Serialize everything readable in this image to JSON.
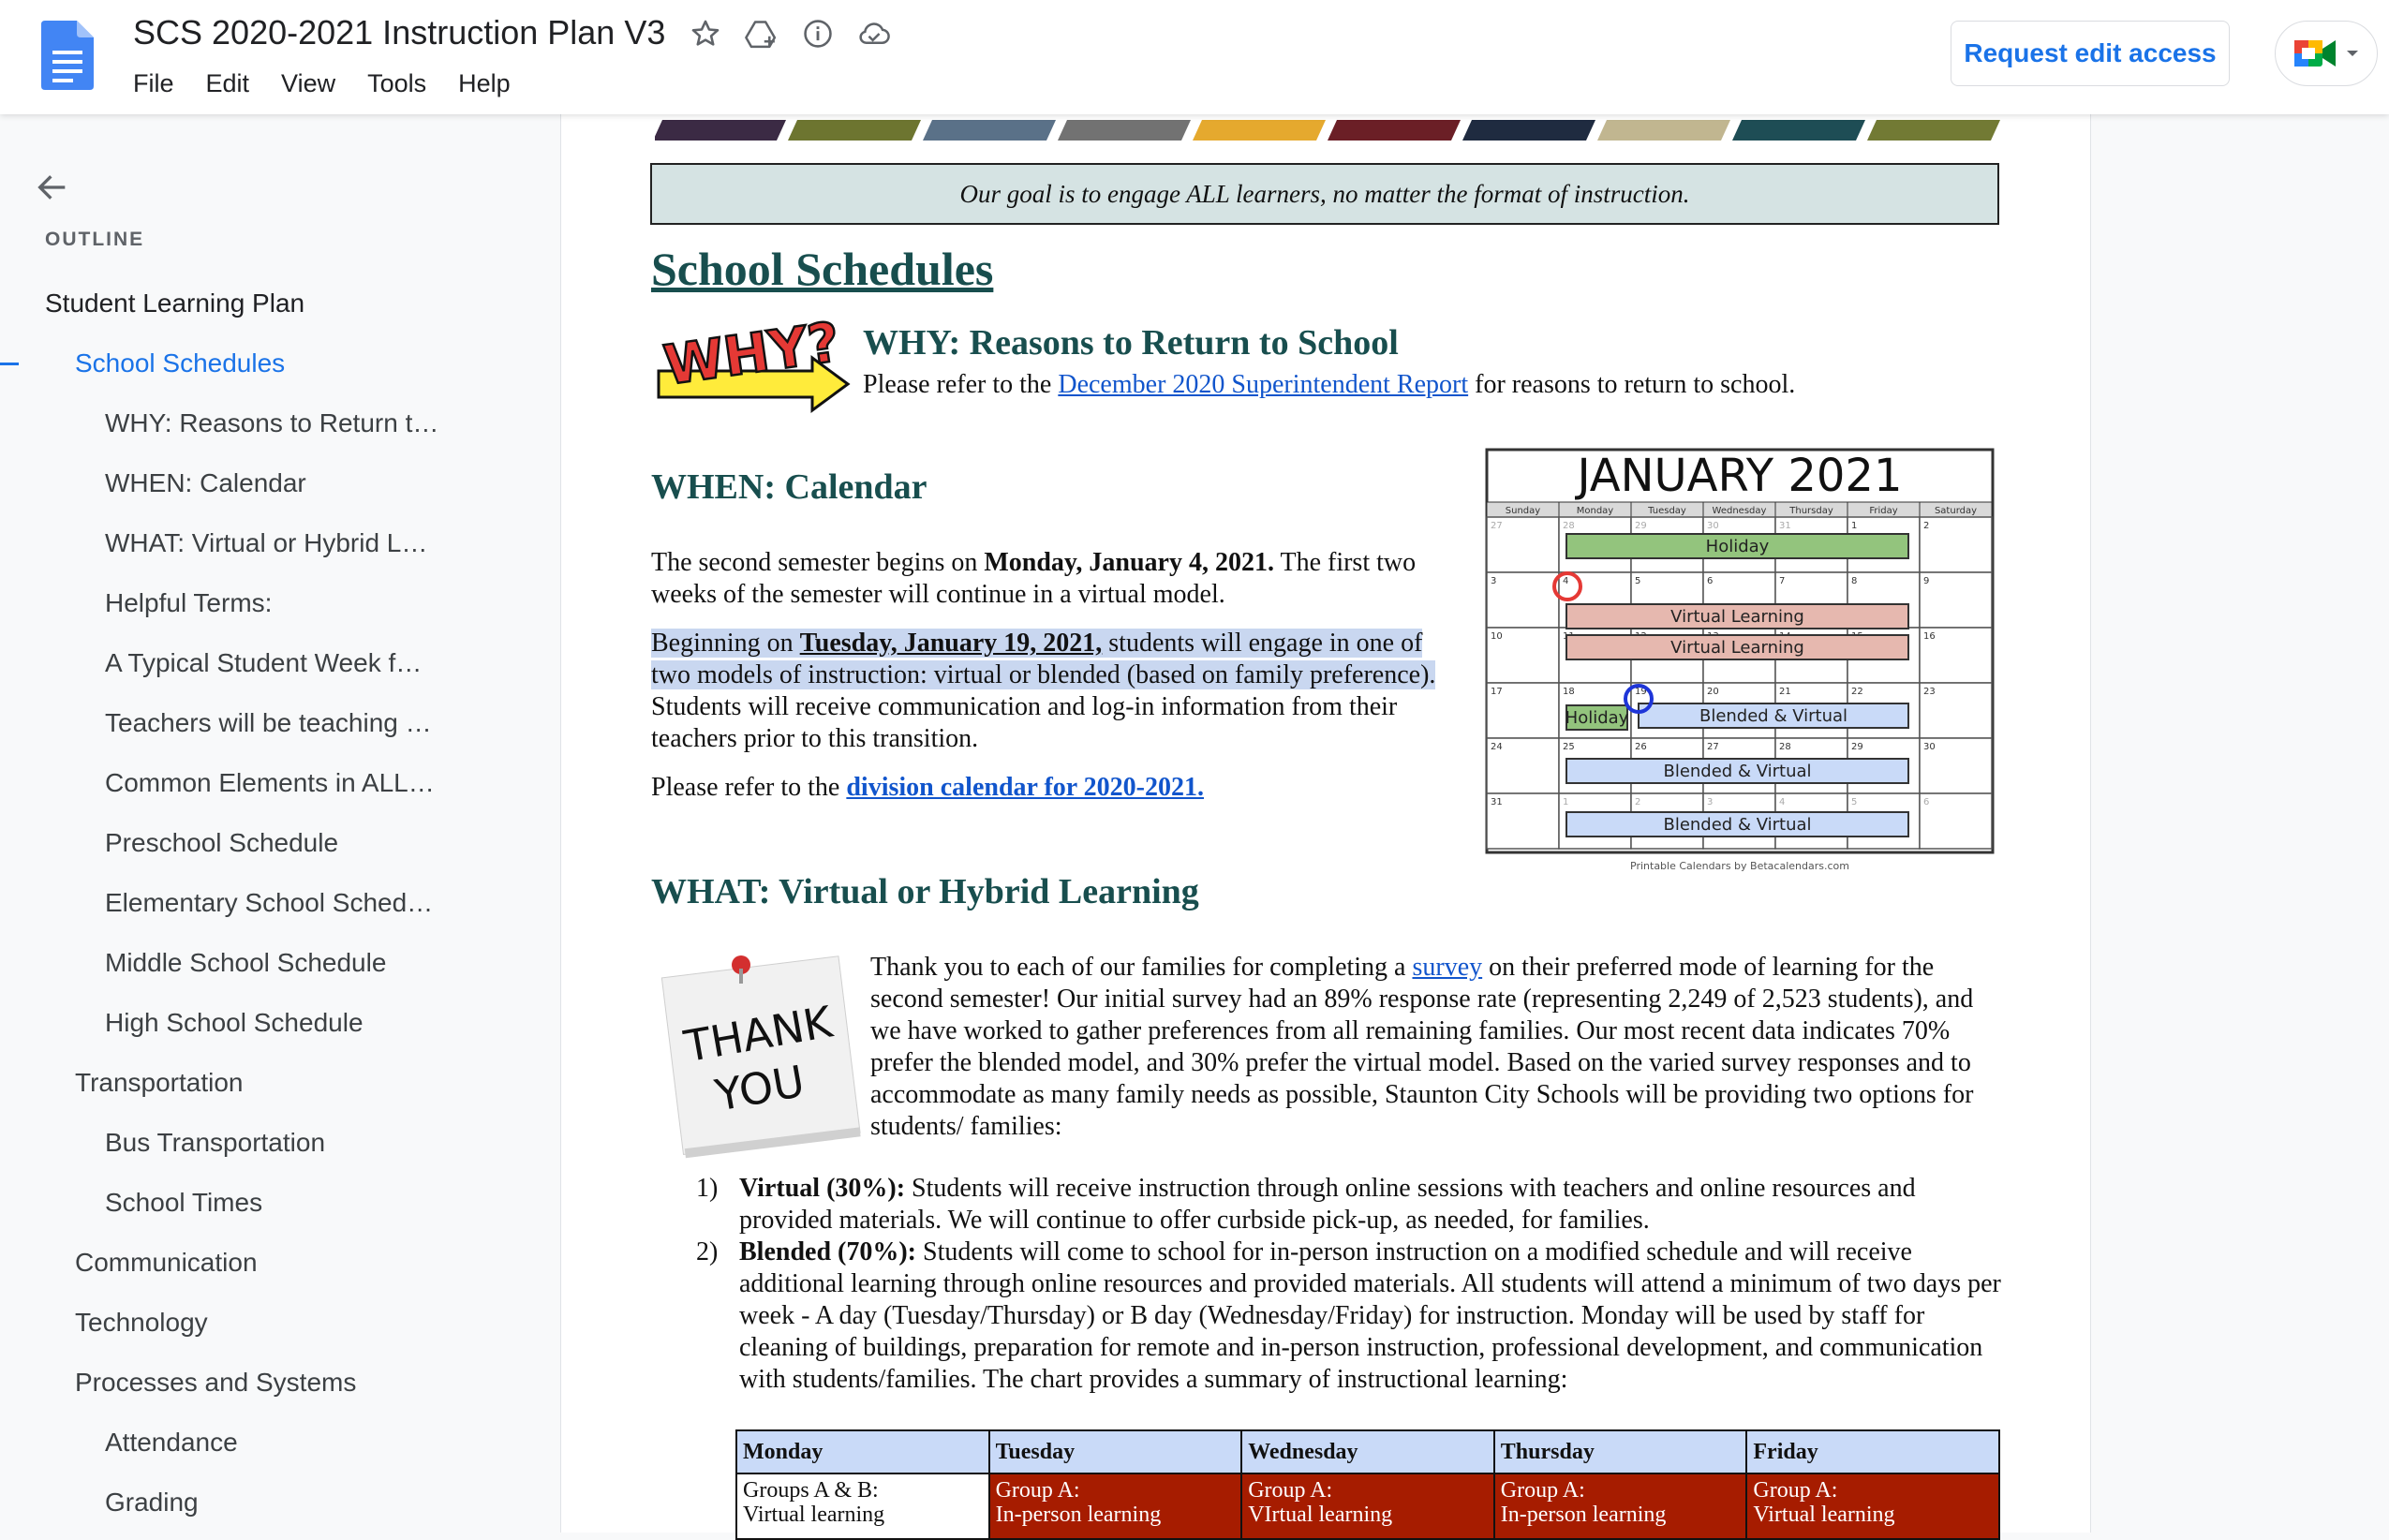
{
  "app": {
    "title": "SCS 2020-2021 Instruction Plan V3",
    "menu": [
      "File",
      "Edit",
      "View",
      "Tools",
      "Help"
    ],
    "request_edit_label": "Request edit access",
    "icons": [
      "star-icon",
      "move-to-drive-icon",
      "info-icon",
      "cloud-status-icon"
    ]
  },
  "sidebar": {
    "heading": "OUTLINE",
    "items": [
      {
        "label": "Student Learning Plan",
        "level": 1
      },
      {
        "label": "School Schedules",
        "level": 2,
        "active": true
      },
      {
        "label": "WHY: Reasons to Return t…",
        "level": 3
      },
      {
        "label": "WHEN: Calendar",
        "level": 3
      },
      {
        "label": "WHAT: Virtual or Hybrid L…",
        "level": 3
      },
      {
        "label": "Helpful Terms:",
        "level": 3
      },
      {
        "label": "A Typical Student Week f…",
        "level": 3
      },
      {
        "label": "Teachers will be teaching …",
        "level": 3
      },
      {
        "label": "Common Elements in ALL…",
        "level": 3
      },
      {
        "label": "Preschool Schedule",
        "level": 3
      },
      {
        "label": "Elementary School Sched…",
        "level": 3
      },
      {
        "label": "Middle School Schedule",
        "level": 3
      },
      {
        "label": "High School Schedule",
        "level": 3
      },
      {
        "label": "Transportation",
        "level": 2
      },
      {
        "label": "Bus Transportation",
        "level": 3
      },
      {
        "label": "School Times",
        "level": 3
      },
      {
        "label": "Communication",
        "level": 2
      },
      {
        "label": "Technology",
        "level": 2
      },
      {
        "label": "Processes and Systems",
        "level": 2
      },
      {
        "label": "Attendance",
        "level": 3
      },
      {
        "label": "Grading",
        "level": 3
      }
    ]
  },
  "doc": {
    "stripe_colors": [
      "#3b2a44",
      "#6d7530",
      "#5a7188",
      "#727272",
      "#e5a92e",
      "#6b1f26",
      "#1f2b40",
      "#c1b690",
      "#1e4d55",
      "#727a34"
    ],
    "goal": "Our goal is to engage ALL learners, no matter the format of instruction.",
    "page_title": "School Schedules",
    "why": {
      "heading": "WHY:  Reasons to Return to School",
      "art_text": "WHY?",
      "pre": "Please refer to the ",
      "link": "December 2020 Superintendent Report",
      "post": " for reasons to return to school."
    },
    "when": {
      "heading": "WHEN:  Calendar",
      "p1_pre": "The second semester begins on ",
      "p1_bold": "Monday, January 4, 2021.",
      "p1_post": "  The first two weeks of the semester will continue in a virtual model.",
      "p2_pre": "Beginning on ",
      "p2_bold": "Tuesday, January 19, 2021,",
      "p2_mid": " students will engage in one of two models of instruction:  virtual or blended (based on family preference).",
      "p2_post": "  Students will receive communication and log-in information from their teachers prior to this transition.",
      "p3_pre": "Please refer to the ",
      "p3_link": "division calendar for 2020-2021."
    },
    "calendar": {
      "title": "JANUARY 2021",
      "days": [
        "Sunday",
        "Monday",
        "Tuesday",
        "Wednesday",
        "Thursday",
        "Friday",
        "Saturday"
      ],
      "weeks": [
        [
          "27",
          "28",
          "29",
          "30",
          "31",
          "1",
          "2"
        ],
        [
          "3",
          "4",
          "5",
          "6",
          "7",
          "8",
          "9"
        ],
        [
          "10",
          "11",
          "12",
          "13",
          "14",
          "15",
          "16"
        ],
        [
          "17",
          "18",
          "19",
          "20",
          "21",
          "22",
          "23"
        ],
        [
          "24",
          "25",
          "26",
          "27",
          "28",
          "29",
          "30"
        ],
        [
          "31",
          "1",
          "2",
          "3",
          "4",
          "5",
          "6"
        ]
      ],
      "bars": [
        {
          "label": "Holiday",
          "color": "#93c47d"
        },
        {
          "label": "Virtual Learning",
          "color": "#e6b8af"
        },
        {
          "label": "Virtual Learning",
          "color": "#e6b8af"
        },
        {
          "label": "Holiday",
          "color": "#93c47d"
        },
        {
          "label": "Blended & Virtual",
          "color": "#c9daf8"
        },
        {
          "label": "Blended & Virtual",
          "color": "#c9daf8"
        },
        {
          "label": "Blended & Virtual",
          "color": "#c9daf8"
        }
      ],
      "credit": "Printable Calendars by Betacalendars.com"
    },
    "what": {
      "heading": "WHAT:  Virtual or Hybrid Learning",
      "note_line1": "THANK",
      "note_line2": "YOU",
      "intro_pre": "Thank you to each of our families for completing a ",
      "intro_link": "survey",
      "intro_post": " on their preferred mode of learning for the second semester!  Our initial survey had an 89% response rate (representing 2,249 of 2,523 students), and we have worked to gather preferences from all remaining families.  Our most recent data indicates 70% prefer the blended model, and 30% prefer the virtual model.  Based on the varied survey responses and to accommodate as many family needs as possible, Staunton City Schools will be providing two options for students/ families:",
      "list": [
        {
          "num": "1)",
          "bold": "Virtual (30%):",
          "text": "  Students will receive instruction through online sessions with teachers and online resources and provided materials.  We will continue to offer curbside pick-up, as needed, for families."
        },
        {
          "num": "2)",
          "bold": "Blended (70%):",
          "text": "  Students will come to school for in-person instruction on a modified schedule and will receive additional learning through online resources and provided materials.  All students will attend a minimum of two days per week - A day (Tuesday/Thursday) or B day (Wednesday/Friday) for instruction.  Monday will be used by staff for cleaning of buildings, preparation for remote and in-person instruction, professional development, and communication with students/families.  The chart provides a summary of instructional learning:"
        }
      ]
    },
    "schedule": {
      "headers": [
        "Monday",
        "Tuesday",
        "Wednesday",
        "Thursday",
        "Friday"
      ],
      "row": [
        [
          "Groups A & B:",
          "Virtual learning"
        ],
        [
          "Group A:",
          "In-person learning"
        ],
        [
          "Group A:",
          "VIrtual learning"
        ],
        [
          "Group A:",
          "In-person learning"
        ],
        [
          "Group A:",
          "Virtual learning"
        ]
      ]
    }
  }
}
